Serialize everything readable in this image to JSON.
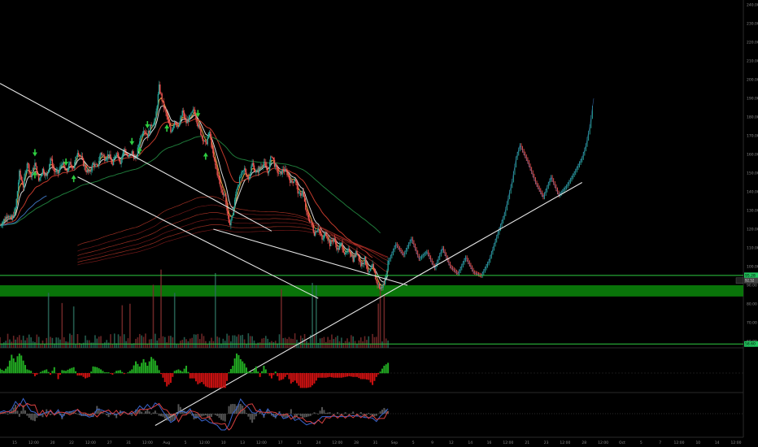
{
  "chart_data": {
    "type": "candlestick",
    "price_axis": {
      "ticks": [
        "240.00",
        "230.00",
        "220.00",
        "210.00",
        "200.00",
        "190.00",
        "180.00",
        "170.00",
        "160.00",
        "150.00",
        "140.00",
        "130.00",
        "120.00",
        "110.00",
        "100.00",
        "90.00",
        "80.00",
        "70.00",
        "60.00"
      ]
    },
    "time_axis": {
      "ticks": [
        "15",
        "12:00",
        "20",
        "22",
        "12:00",
        "27",
        "31",
        "12:00",
        "Aug",
        "5",
        "12:00",
        "10",
        "13",
        "12:00",
        "17",
        "21",
        "24",
        "12:00",
        "28",
        "31",
        "Sep",
        "5",
        "9",
        "12",
        "14",
        "16",
        "12:00",
        "21",
        "23",
        "12:00",
        "28",
        "12:00",
        "Oct",
        "5",
        "7",
        "12:00",
        "10",
        "14",
        "12:00"
      ]
    },
    "price_labels": [
      {
        "name": "upper-level",
        "value": "95.28",
        "color": "#22c55e"
      },
      {
        "name": "last-price",
        "value": "92.52",
        "color": "#444444"
      },
      {
        "name": "lower-level",
        "value": "58.60",
        "color": "#22c55e"
      }
    ],
    "support_zone": {
      "from": 84,
      "to": 90,
      "color": "#0a7a0a"
    },
    "horizontal_levels": [
      95.28,
      58.6
    ],
    "trendlines": [
      {
        "name": "channel-upper",
        "points": [
          [
            0,
            198
          ],
          [
            70,
            119
          ]
        ]
      },
      {
        "name": "channel-lower",
        "points": [
          [
            20,
            148
          ],
          [
            82,
            83
          ]
        ]
      },
      {
        "name": "rising-support",
        "points": [
          [
            40,
            15
          ],
          [
            150,
            145
          ]
        ]
      },
      {
        "name": "falling-projection",
        "points": [
          [
            55,
            120
          ],
          [
            105,
            90
          ]
        ]
      }
    ],
    "signal_arrows": [
      {
        "t": 9,
        "dir": "down"
      },
      {
        "t": 17,
        "dir": "down"
      },
      {
        "t": 34,
        "dir": "down"
      },
      {
        "t": 38,
        "dir": "down"
      },
      {
        "t": 51,
        "dir": "down"
      },
      {
        "t": 9,
        "dir": "up"
      },
      {
        "t": 19,
        "dir": "up"
      },
      {
        "t": 36,
        "dir": "up"
      },
      {
        "t": 43,
        "dir": "up"
      },
      {
        "t": 53,
        "dir": "up"
      }
    ],
    "close_path": [
      [
        0,
        122
      ],
      [
        2,
        128
      ],
      [
        3,
        125
      ],
      [
        4,
        131
      ],
      [
        5,
        150
      ],
      [
        6,
        143
      ],
      [
        7,
        156
      ],
      [
        8,
        148
      ],
      [
        9,
        155
      ],
      [
        10,
        146
      ],
      [
        11,
        152
      ],
      [
        12,
        148
      ],
      [
        13,
        158
      ],
      [
        14,
        151
      ],
      [
        15,
        150
      ],
      [
        16,
        156
      ],
      [
        17,
        150
      ],
      [
        18,
        155
      ],
      [
        19,
        153
      ],
      [
        20,
        162
      ],
      [
        21,
        158
      ],
      [
        22,
        152
      ],
      [
        23,
        150
      ],
      [
        24,
        155
      ],
      [
        25,
        153
      ],
      [
        26,
        161
      ],
      [
        27,
        158
      ],
      [
        28,
        160
      ],
      [
        29,
        154
      ],
      [
        30,
        162
      ],
      [
        31,
        156
      ],
      [
        32,
        163
      ],
      [
        33,
        158
      ],
      [
        34,
        161
      ],
      [
        35,
        157
      ],
      [
        36,
        168
      ],
      [
        37,
        174
      ],
      [
        38,
        170
      ],
      [
        39,
        176
      ],
      [
        40,
        178
      ],
      [
        41,
        196
      ],
      [
        42,
        187
      ],
      [
        43,
        180
      ],
      [
        44,
        172
      ],
      [
        45,
        178
      ],
      [
        46,
        174
      ],
      [
        47,
        183
      ],
      [
        48,
        177
      ],
      [
        49,
        180
      ],
      [
        50,
        184
      ],
      [
        51,
        176
      ],
      [
        52,
        170
      ],
      [
        53,
        165
      ],
      [
        54,
        172
      ],
      [
        55,
        158
      ],
      [
        56,
        150
      ],
      [
        57,
        141
      ],
      [
        58,
        138
      ],
      [
        59,
        122
      ],
      [
        60,
        128
      ],
      [
        61,
        142
      ],
      [
        62,
        148
      ],
      [
        63,
        152
      ],
      [
        64,
        147
      ],
      [
        65,
        155
      ],
      [
        66,
        150
      ],
      [
        67,
        153
      ],
      [
        68,
        156
      ],
      [
        69,
        150
      ],
      [
        70,
        160
      ],
      [
        71,
        153
      ],
      [
        72,
        149
      ],
      [
        73,
        152
      ],
      [
        74,
        150
      ],
      [
        75,
        145
      ],
      [
        76,
        147
      ],
      [
        77,
        138
      ],
      [
        78,
        140
      ],
      [
        79,
        128
      ],
      [
        80,
        124
      ],
      [
        81,
        118
      ],
      [
        82,
        121
      ],
      [
        83,
        114
      ],
      [
        84,
        118
      ],
      [
        85,
        112
      ],
      [
        86,
        115
      ],
      [
        87,
        109
      ],
      [
        88,
        112
      ],
      [
        89,
        106
      ],
      [
        90,
        109
      ],
      [
        91,
        104
      ],
      [
        92,
        108
      ],
      [
        93,
        101
      ],
      [
        94,
        104
      ],
      [
        95,
        96
      ],
      [
        96,
        100
      ],
      [
        97,
        92
      ],
      [
        98,
        88
      ],
      [
        99,
        91
      ],
      [
        100,
        102
      ],
      [
        102,
        112
      ],
      [
        104,
        106
      ],
      [
        106,
        115
      ],
      [
        108,
        104
      ],
      [
        110,
        108
      ],
      [
        112,
        99
      ],
      [
        114,
        110
      ],
      [
        116,
        100
      ],
      [
        118,
        96
      ],
      [
        120,
        105
      ],
      [
        122,
        97
      ],
      [
        124,
        95
      ],
      [
        126,
        103
      ],
      [
        128,
        116
      ],
      [
        130,
        128
      ],
      [
        132,
        146
      ],
      [
        133,
        158
      ],
      [
        134,
        165
      ],
      [
        136,
        156
      ],
      [
        138,
        145
      ],
      [
        140,
        137
      ],
      [
        142,
        148
      ],
      [
        144,
        138
      ],
      [
        146,
        143
      ],
      [
        148,
        150
      ],
      [
        150,
        158
      ],
      [
        151,
        165
      ],
      [
        152,
        175
      ],
      [
        153,
        190
      ]
    ],
    "moving_averages": [
      {
        "name": "ema-fast",
        "color": "#e8a33c"
      },
      {
        "name": "ema-mid",
        "color": "#d8d8d8"
      },
      {
        "name": "ema-slow",
        "color": "#c0392b"
      },
      {
        "name": "sma-long",
        "color": "#1f7a3a"
      },
      {
        "name": "sma-blue",
        "color": "#3b6fb6"
      }
    ]
  }
}
